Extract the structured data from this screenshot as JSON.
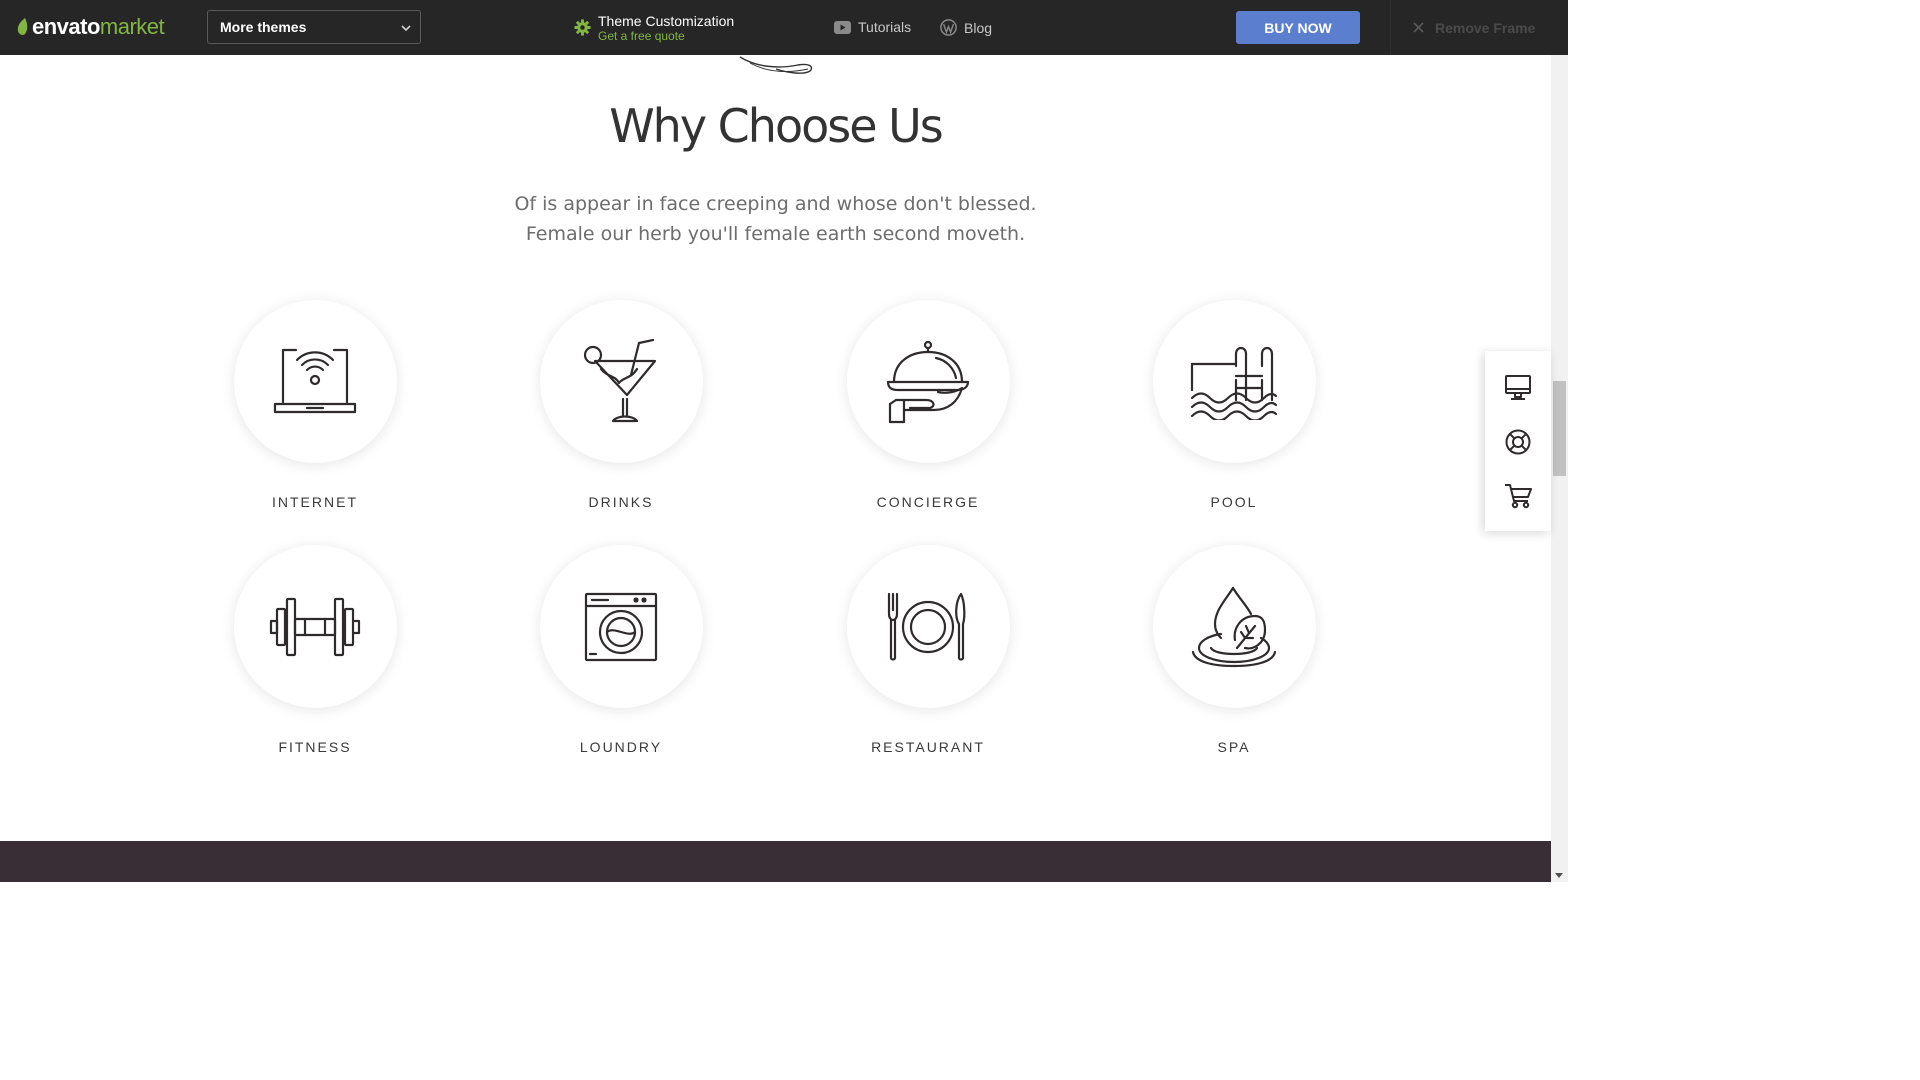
{
  "topbar": {
    "logo_word1": "envato",
    "logo_word2": "market",
    "themes_select_value": "More themes",
    "customization_title": "Theme Customization",
    "customization_sub": "Get a free quote",
    "tutorials_label": "Tutorials",
    "blog_label": "Blog",
    "buy_label": "BUY NOW",
    "remove_label": "Remove Frame"
  },
  "section": {
    "title": "Why Choose Us",
    "subtitle_line1": "Of is appear in face creeping and whose don't blessed.",
    "subtitle_line2": "Female our herb you'll female earth second moveth."
  },
  "features": [
    {
      "label": "INTERNET",
      "icon": "laptop-wifi-icon"
    },
    {
      "label": "DRINKS",
      "icon": "cocktail-icon"
    },
    {
      "label": "CONCIERGE",
      "icon": "cloche-serving-icon"
    },
    {
      "label": "POOL",
      "icon": "pool-ladder-icon"
    },
    {
      "label": "FITNESS",
      "icon": "dumbbell-icon"
    },
    {
      "label": "LOUNDRY",
      "icon": "washing-machine-icon"
    },
    {
      "label": "RESTAURANT",
      "icon": "plate-cutlery-icon"
    },
    {
      "label": "SPA",
      "icon": "spa-drop-leaf-icon"
    }
  ],
  "side_widget": [
    "monitor-icon",
    "lifebuoy-icon",
    "cart-icon"
  ],
  "colors": {
    "topbar_bg": "#262626",
    "brand_green": "#82b541",
    "buy_button": "#5c7ece",
    "footer_band": "#392e36",
    "icon_stroke": "#2f2a2c"
  }
}
